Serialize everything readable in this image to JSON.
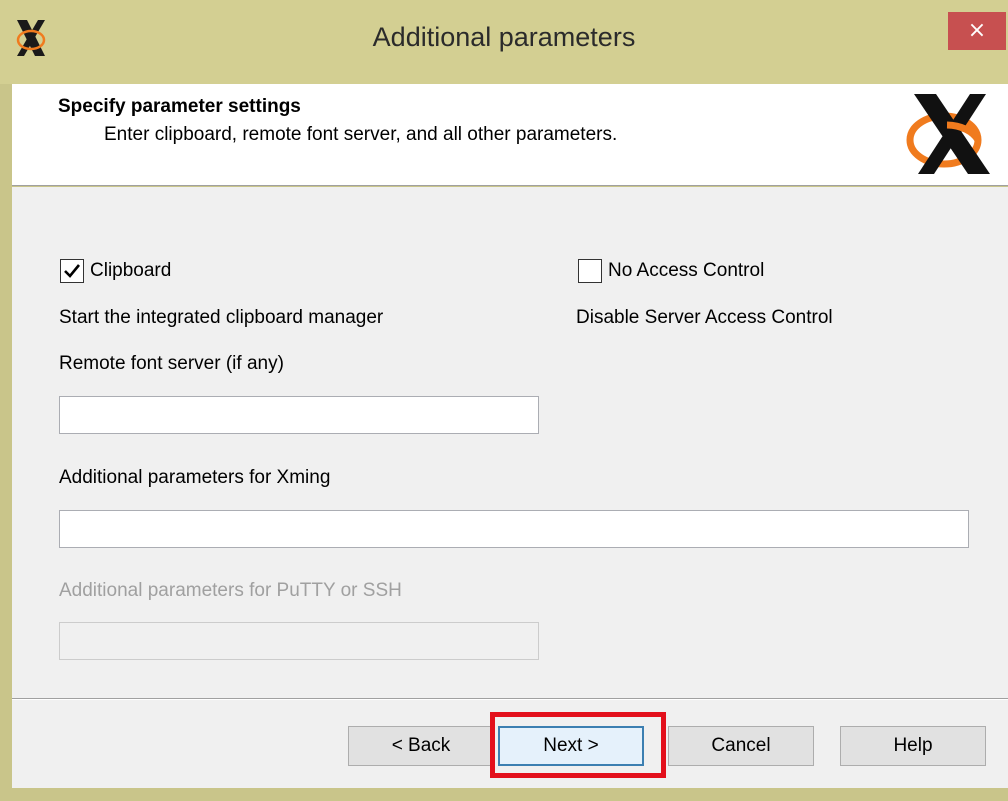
{
  "window": {
    "title": "Additional parameters",
    "close_glyph": "×"
  },
  "header": {
    "title": "Specify parameter settings",
    "subtitle": "Enter clipboard, remote font server, and all other parameters."
  },
  "options": {
    "clipboard": {
      "label": "Clipboard",
      "checked": true,
      "description": "Start the integrated clipboard manager"
    },
    "no_access_control": {
      "label": "No Access Control",
      "checked": false,
      "description": "Disable Server Access Control"
    }
  },
  "fields": {
    "font_server": {
      "label": "Remote font server (if any)",
      "value": ""
    },
    "xming_params": {
      "label": "Additional parameters for Xming",
      "value": ""
    },
    "putty_params": {
      "label": "Additional parameters for PuTTY or SSH",
      "value": "",
      "disabled": true
    }
  },
  "buttons": {
    "back": "< Back",
    "next": "Next >",
    "cancel": "Cancel",
    "help": "Help"
  },
  "colors": {
    "titlebar": "#d3cf92",
    "close": "#c75050",
    "highlight": "#e3101c",
    "logo_orange": "#f07b1e"
  },
  "icons": {
    "app": "x-logo-icon",
    "header": "x-logo-icon",
    "close": "close-icon",
    "checkmark": "checkmark-icon"
  }
}
